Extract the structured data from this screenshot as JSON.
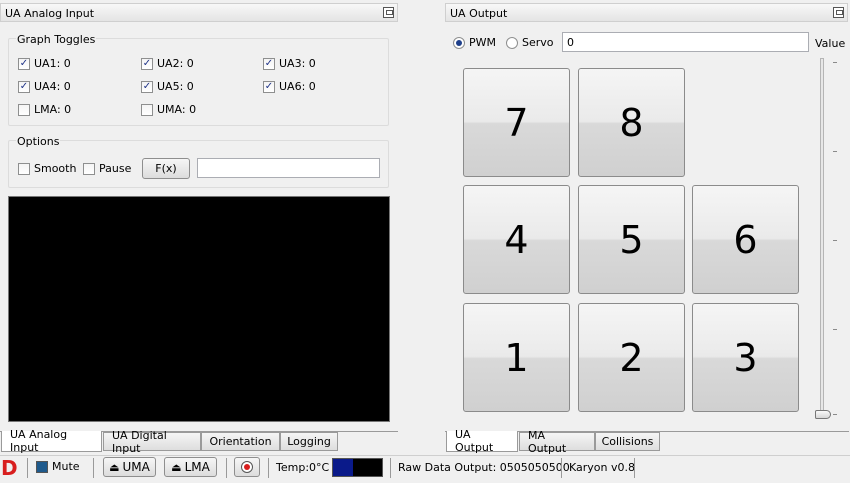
{
  "left_panel": {
    "title": "UA Analog Input",
    "graph_toggles": {
      "title": "Graph Toggles",
      "items": [
        {
          "label": "UA1: 0",
          "checked": true
        },
        {
          "label": "UA2: 0",
          "checked": true
        },
        {
          "label": "UA3: 0",
          "checked": true
        },
        {
          "label": "UA4: 0",
          "checked": true
        },
        {
          "label": "UA5: 0",
          "checked": true
        },
        {
          "label": "UA6: 0",
          "checked": true
        },
        {
          "label": "LMA: 0",
          "checked": false
        },
        {
          "label": "UMA: 0",
          "checked": false
        }
      ]
    },
    "options": {
      "title": "Options",
      "smooth_label": "Smooth",
      "pause_label": "Pause",
      "fx_label": "F(x)",
      "fx_value": ""
    },
    "tabs": [
      {
        "label": "UA Analog Input",
        "active": true
      },
      {
        "label": "UA Digital Input",
        "active": false
      },
      {
        "label": "Orientation",
        "active": false
      },
      {
        "label": "Logging",
        "active": false
      }
    ]
  },
  "right_panel": {
    "title": "UA Output",
    "mode": {
      "pwm_label": "PWM",
      "servo_label": "Servo",
      "selected": "PWM"
    },
    "value_input": "0",
    "value_label": "Value",
    "slider_level": 0,
    "keypad": [
      "7",
      "8",
      "4",
      "5",
      "6",
      "1",
      "2",
      "3"
    ],
    "tabs": [
      {
        "label": "UA Output",
        "active": true
      },
      {
        "label": "MA Output",
        "active": false
      },
      {
        "label": "Collisions",
        "active": false
      }
    ]
  },
  "status_bar": {
    "logo": "D",
    "mute_label": "Mute",
    "uma_label": "UMA",
    "lma_label": "LMA",
    "temp": "Temp:0°C",
    "raw_data": "Raw Data Output: 0505050500",
    "version": "Karyon v0.8"
  },
  "colors": {
    "logo_red": "#d81e1e",
    "temp_bar_blue": "#0a1a8a",
    "graph_bg": "#000000"
  }
}
